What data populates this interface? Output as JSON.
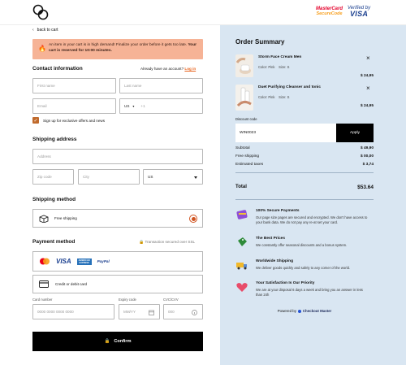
{
  "trust": {
    "mastercard_line1": "MasterCard",
    "mastercard_line2": "SecureCode",
    "verified_line1": "Verified by",
    "verified_line2": "VISA"
  },
  "back_label": "back to cart",
  "alert": {
    "text": "An item in your cart is in high demand! Finalize your order before it gets too late.",
    "strong": "Your cart is reserved for 10:00 minutes."
  },
  "contact": {
    "title": "Contact information",
    "account_prompt": "Already have an account?",
    "login": "Log in",
    "first_name": "First name",
    "last_name": "Last name",
    "email": "Email",
    "country_code": "US",
    "phone_prefix": "+1",
    "newsletter": "Sign up for exclusive offers and news"
  },
  "shipping": {
    "title": "Shipping address",
    "address": "Address",
    "zip": "Zip code",
    "city": "City",
    "country": "US"
  },
  "shipping_method": {
    "title": "Shipping method",
    "option": "Free shipping"
  },
  "payment": {
    "title": "Payment method",
    "secure_note": "Transaction secured over SSL",
    "brands": [
      "MC",
      "VISA",
      "AMERICAN EXPRESS",
      "PayPal"
    ],
    "card_option": "Credit or debit card",
    "card_number_label": "Card number",
    "card_number_placeholder": "0000  0000  0000  0000",
    "expiry_label": "Expiry code",
    "expiry_placeholder": "MM/YY",
    "cvc_label": "CVC/CVV",
    "cvc_placeholder": "000",
    "confirm": "Confirm"
  },
  "order": {
    "title": "Order Summary",
    "items": [
      {
        "name": "Storm Face Cream Men",
        "color": "Color: Pink",
        "size": "Size: S",
        "price": "$ 24,95",
        "close": "×"
      },
      {
        "name": "Duet Purifying Cleanser and tonic",
        "color": "Color: Pink",
        "size": "Size: S",
        "price": "$ 24,95",
        "close": "×"
      }
    ],
    "discount_label": "Discount code",
    "discount_value": "WIN0023",
    "apply": "Apply",
    "subtotal_label": "Subtotal",
    "subtotal": "$ 49,90",
    "free_shipping_label": "Free shipping",
    "free_shipping": "$ 00,00",
    "taxes_label": "Estimated taxes",
    "taxes": "$ 3,74",
    "total_label": "Total",
    "total": "$53.64"
  },
  "features": [
    {
      "title": "100% Secure Payments",
      "desc": "Our page size pages are secured and encrypted. We don't have access to your bank data. We do not pay any re-at set your card."
    },
    {
      "title": "The Best Prices",
      "desc": "We constantly offer seasonal discounts and a bonus system."
    },
    {
      "title": "Worldwide Shipping",
      "desc": "We deliver goods quickly and safely to any corner of the world."
    },
    {
      "title": "Your Satisfaction Is Our Priority",
      "desc": "We are at your disposal 6 days a week and bring you an answer in less than 24h"
    }
  ],
  "powered": {
    "prefix": "Powered by",
    "brand": "Checkout Master"
  },
  "colors": {
    "accent": "#e8621b",
    "alert_bg": "#f6b396",
    "summary_bg": "#d9e6f2",
    "checkbox": "#c06a2c"
  }
}
